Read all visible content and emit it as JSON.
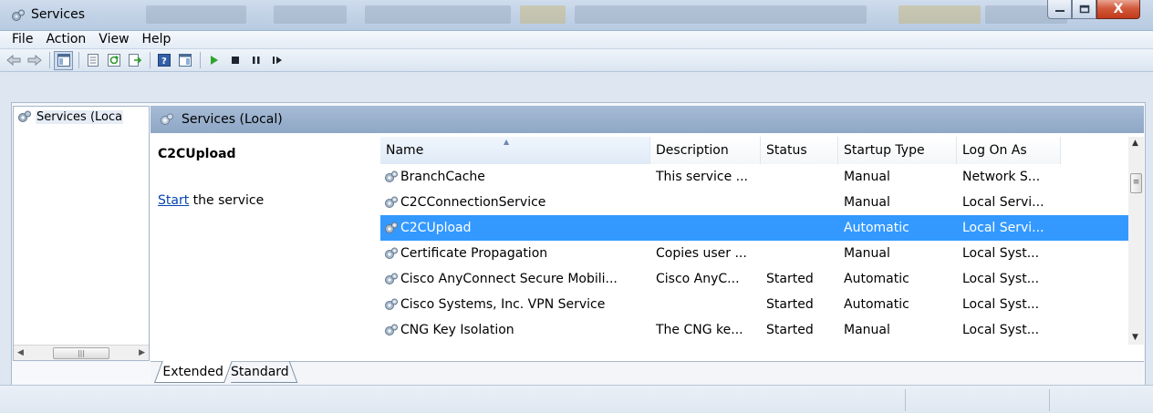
{
  "window": {
    "title": "Services",
    "close_label": "X"
  },
  "menu": [
    "File",
    "Action",
    "View",
    "Help"
  ],
  "tree": {
    "root_label": "Services (Loca"
  },
  "header": {
    "title": "Services (Local)"
  },
  "extended": {
    "service_name": "C2CUpload",
    "start_link": "Start",
    "start_suffix": " the service"
  },
  "columns": [
    "Name",
    "Description",
    "Status",
    "Startup Type",
    "Log On As"
  ],
  "rows": [
    {
      "name": "BranchCache",
      "description": "This service ...",
      "status": "",
      "startup": "Manual",
      "logon": "Network S..."
    },
    {
      "name": "C2CConnectionService",
      "description": "",
      "status": "",
      "startup": "Manual",
      "logon": "Local Servi..."
    },
    {
      "name": "C2CUpload",
      "description": "",
      "status": "",
      "startup": "Automatic",
      "logon": "Local Servi...",
      "selected": true
    },
    {
      "name": "Certificate Propagation",
      "description": "Copies user ...",
      "status": "",
      "startup": "Manual",
      "logon": "Local Syst..."
    },
    {
      "name": "Cisco AnyConnect Secure Mobili...",
      "description": "Cisco AnyC...",
      "status": "Started",
      "startup": "Automatic",
      "logon": "Local Syst..."
    },
    {
      "name": "Cisco Systems, Inc. VPN Service",
      "description": "",
      "status": "Started",
      "startup": "Automatic",
      "logon": "Local Syst..."
    },
    {
      "name": "CNG Key Isolation",
      "description": "The CNG ke...",
      "status": "Started",
      "startup": "Manual",
      "logon": "Local Syst..."
    }
  ],
  "tabs": [
    "Extended",
    "Standard"
  ],
  "icons": {
    "app": "services-gear-icon",
    "row": "service-gear-icon"
  },
  "colors": {
    "selection": "#3399ff",
    "header_bar": "#97aecb",
    "link": "#0645ad"
  }
}
